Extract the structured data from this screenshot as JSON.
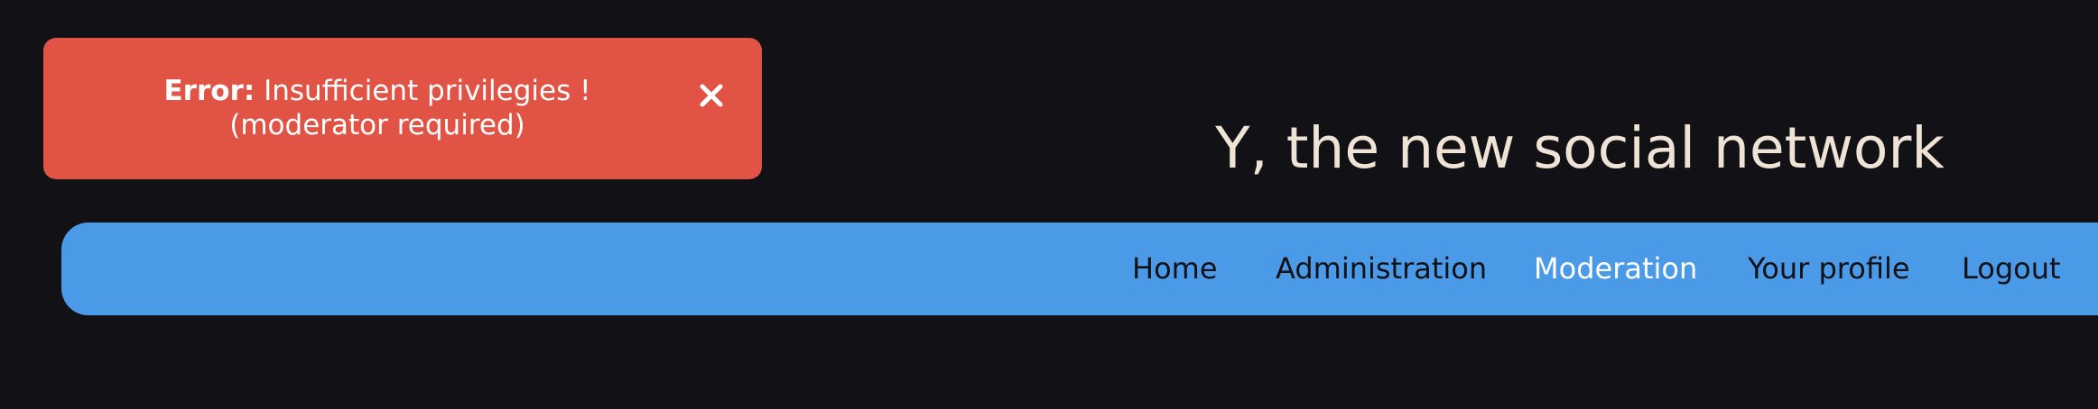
{
  "toast": {
    "prefix": "Error:",
    "message": " Insufficient privilegies ! (moderator required)",
    "close_icon": "close-icon",
    "background": "#e15345"
  },
  "header": {
    "title": "Y, the new social network"
  },
  "nav": {
    "items": [
      {
        "label": "Home",
        "active": false
      },
      {
        "label": "Administration",
        "active": false
      },
      {
        "label": "Moderation",
        "active": true
      },
      {
        "label": "Your profile",
        "active": false
      },
      {
        "label": "Logout",
        "active": false
      }
    ],
    "background": "#4a9ae8"
  },
  "colors": {
    "page_background": "#111116",
    "title_text": "#eee3d4",
    "nav_text": "#111116",
    "nav_active_text": "#ffffff"
  }
}
